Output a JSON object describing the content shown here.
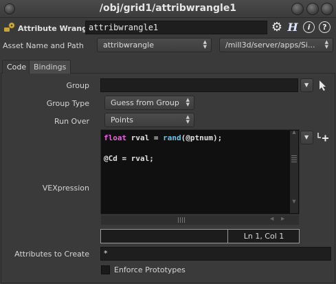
{
  "window": {
    "title": "/obj/grid1/attribwrangle1"
  },
  "header": {
    "node_type": "Attribute Wrangle",
    "node_name": "attribwrangle1",
    "gear_glyph": "⚙",
    "h_glyph": "H",
    "info_glyph": "i",
    "help_glyph": "?"
  },
  "asset": {
    "label": "Asset Name and Path",
    "name_value": "attribwrangle",
    "path_value": "/mill3d/server/apps/Si..."
  },
  "tabs": [
    {
      "label": "Code",
      "active": true
    },
    {
      "label": "Bindings",
      "active": false
    }
  ],
  "params": {
    "group_label": "Group",
    "group_value": "",
    "group_type_label": "Group Type",
    "group_type_value": "Guess from Group",
    "run_over_label": "Run Over",
    "run_over_value": "Points",
    "vex_label": "VEXpression",
    "code": {
      "line1": {
        "kw": "float",
        "a": " rval = ",
        "fn": "rand",
        "b": "(@ptnum);"
      },
      "line2": "@Cd = rval;"
    },
    "cursor_position": "Ln 1, Col 1",
    "attributes_label": "Attributes to Create",
    "attributes_value": "*",
    "enforce_label": "Enforce Prototypes",
    "enforce_checked": false
  },
  "icons": {
    "node": "wrangle-node-icon",
    "gear": "gear-icon",
    "h": "houdini-h-icon",
    "info": "info-icon",
    "help": "help-icon",
    "arrow": "select-arrow-icon",
    "dropdown": "dropdown-triangle-icon",
    "plus": "create-parameter-icon",
    "grip": "resize-grip-icon"
  },
  "colors": {
    "keyword": "#e06bd8",
    "function": "#6fc3e6",
    "background": "#3a3a3a",
    "field": "#1e1e1e"
  }
}
